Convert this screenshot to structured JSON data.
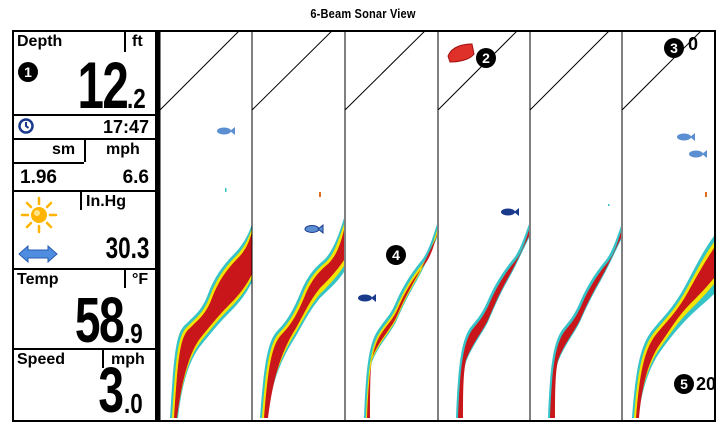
{
  "title": "6-Beam Sonar View",
  "panel": {
    "depth_label": "Depth",
    "depth_unit": "ft",
    "depth_whole": "12",
    "depth_decimal": ".2",
    "time": "17:47",
    "distance_unit": "sm",
    "speed_unit_top": "mph",
    "distance_value": "1.96",
    "speed_value_top": "6.6",
    "pressure_unit": "In.Hg",
    "pressure_value": "30.3",
    "temp_label": "Temp",
    "temp_unit": "°F",
    "temp_whole": "58",
    "temp_decimal": ".9",
    "speed_label": "Speed",
    "speed_unit": "mph",
    "speed_whole": "3",
    "speed_decimal": ".0"
  },
  "callouts": {
    "c1": "1",
    "c2": "2",
    "c3": "3",
    "c4": "4",
    "c5": "5"
  },
  "scale": {
    "top": "0",
    "bottom": "20"
  },
  "colors": {
    "return_red": "#c8161b",
    "return_yellow": "#f2e300",
    "return_cyan": "#36c3c8",
    "fish_blue": "#5b8fd1",
    "fish_dark": "#1a3a8c",
    "boat_red": "#e0302a",
    "sun": "#ffb400",
    "arrow_blue": "#4f8de0"
  },
  "icons": [
    "clock-icon",
    "sun-icon",
    "pressure-arrow-icon",
    "fish-icon",
    "boat-icon"
  ]
}
